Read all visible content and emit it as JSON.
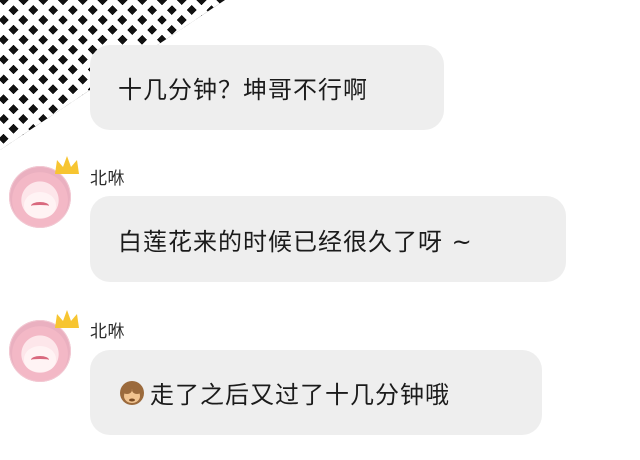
{
  "messages": [
    {
      "id": "m1",
      "sender": "",
      "text": "十几分钟？坤哥不行啊",
      "avatar_icon": "houndstooth-avatar-icon"
    },
    {
      "id": "m2",
      "sender": "北咻",
      "text": "白莲花来的时候已经很久了呀 ~",
      "avatar_icon": "pink-hair-anime-girl-avatar-icon"
    },
    {
      "id": "m3",
      "sender": "北咻",
      "emoji_icon": "see-no-evil-monkey-icon",
      "text": "走了之后又过了十几分钟哦",
      "avatar_icon": "pink-hair-anime-girl-avatar-icon"
    }
  ],
  "colors": {
    "bubble_background": "#eeeeee",
    "page_background": "#ffffff",
    "avatar_pink": "#f3b8c6",
    "crown_yellow": "#f7c531"
  }
}
